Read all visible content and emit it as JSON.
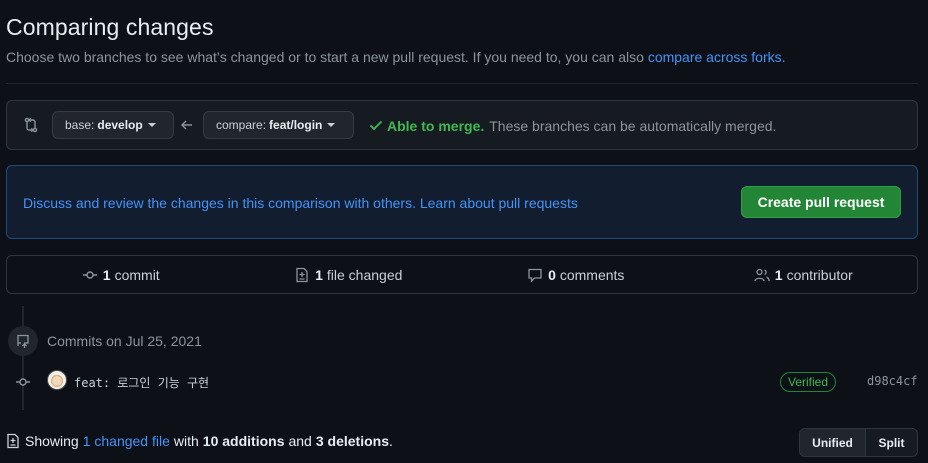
{
  "header": {
    "title": "Comparing changes",
    "subtitle_text": "Choose two branches to see what’s changed or to start a new pull request. If you need to, you can also",
    "subtitle_link": "compare across forks."
  },
  "range": {
    "base_label": "base:",
    "base_branch": "develop",
    "compare_label": "compare:",
    "compare_branch": "feat/login",
    "merge_status": "Able to merge.",
    "merge_detail": "These branches can be automatically merged."
  },
  "info": {
    "text": "Discuss and review the changes in this comparison with others.",
    "link": "Learn about pull requests",
    "create_button": "Create pull request"
  },
  "stats": {
    "commits_count": "1",
    "commits_label": "commit",
    "files_count": "1",
    "files_label": "file changed",
    "comments_count": "0",
    "comments_label": "comments",
    "contributors_count": "1",
    "contributors_label": "contributor"
  },
  "commits": {
    "date_heading": "Commits on Jul 25, 2021",
    "items": [
      {
        "message": "feat: 로그인 기능 구현",
        "badge": "Verified",
        "sha": "d98c4cf"
      }
    ]
  },
  "files_summary": {
    "prefix": "Showing",
    "changed_link": "1 changed file",
    "with": "with",
    "additions": "10 additions",
    "and": "and",
    "deletions": "3 deletions",
    "suffix": "."
  },
  "view_toggle": {
    "unified": "Unified",
    "split": "Split",
    "selected": "Unified"
  },
  "colors": {
    "accent_link": "#4493f8",
    "success": "#3fb950",
    "primary_button": "#238636",
    "background": "#0d1117"
  }
}
